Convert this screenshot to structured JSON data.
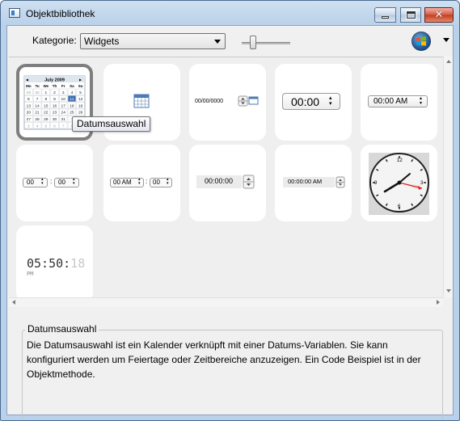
{
  "window": {
    "title": "Objektbibliothek"
  },
  "toolbar": {
    "category_label": "Kategorie:",
    "category_value": "Widgets"
  },
  "tooltip": "Datumsauswahl",
  "tiles": {
    "calendar_month": "July 2009",
    "calendar_weekdays": [
      "Mo",
      "Tu",
      "We",
      "Th",
      "Fr",
      "Sa",
      "Su"
    ],
    "calendar_days": [
      [
        "29",
        "30",
        "1",
        "2",
        "3",
        "4",
        "5"
      ],
      [
        "6",
        "7",
        "8",
        "9",
        "10",
        "11",
        "12"
      ],
      [
        "13",
        "14",
        "15",
        "16",
        "17",
        "18",
        "19"
      ],
      [
        "20",
        "21",
        "22",
        "23",
        "24",
        "25",
        "26"
      ],
      [
        "27",
        "28",
        "29",
        "30",
        "31",
        "1",
        "2"
      ],
      [
        "3",
        "4",
        "5",
        "6",
        "7",
        "8",
        "9"
      ]
    ],
    "date_field": "00/00/0000",
    "time_large": "00:00",
    "time_ampm": "00:00 AM",
    "hour": "00",
    "minute": "00",
    "hour_ampm": "00 AM",
    "time_plain": "00:00:00",
    "time_plain_ampm": "00:00:00 AM",
    "digital_clock": "05:50:",
    "digital_clock_faded": "18",
    "digital_clock_suffix": "PM"
  },
  "description": {
    "title": "Datumsauswahl",
    "text": "Die Datumsauswahl ist ein Kalender verknüpft mit einer Datums-Variablen. Sie kann konfiguriert werden um Feiertage oder Zeitbereiche anzuzeigen. Ein Code Beispiel ist in der Objektmethode."
  }
}
